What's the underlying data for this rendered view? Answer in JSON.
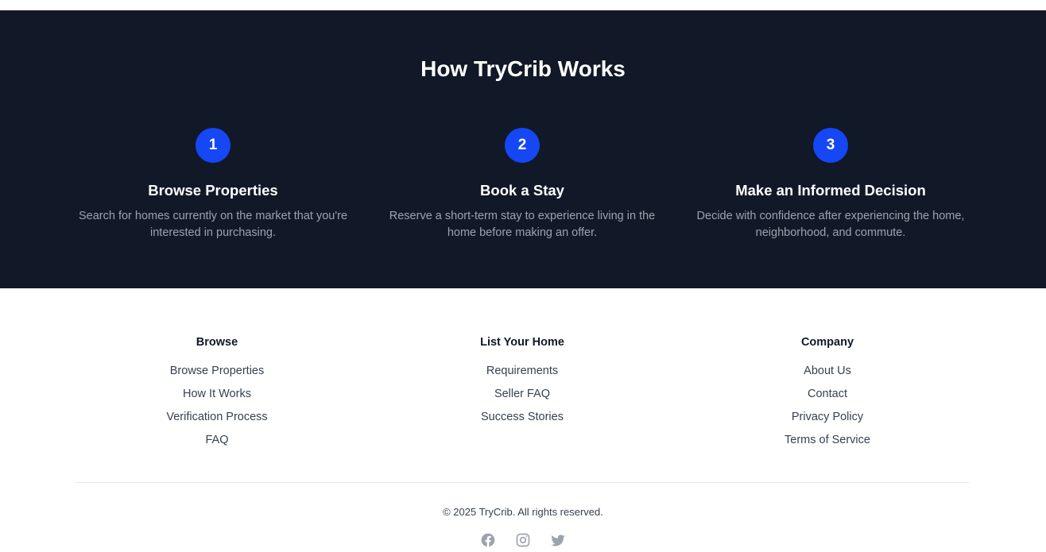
{
  "how_it_works": {
    "title": "How TryCrib Works",
    "steps": [
      {
        "number": "1",
        "heading": "Browse Properties",
        "description": "Search for homes currently on the market that you're interested in purchasing."
      },
      {
        "number": "2",
        "heading": "Book a Stay",
        "description": "Reserve a short-term stay to experience living in the home before making an offer."
      },
      {
        "number": "3",
        "heading": "Make an Informed Decision",
        "description": "Decide with confidence after experiencing the home, neighborhood, and commute."
      }
    ]
  },
  "footer": {
    "columns": [
      {
        "title": "Browse",
        "links": [
          "Browse Properties",
          "How It Works",
          "Verification Process",
          "FAQ"
        ]
      },
      {
        "title": "List Your Home",
        "links": [
          "Requirements",
          "Seller FAQ",
          "Success Stories"
        ]
      },
      {
        "title": "Company",
        "links": [
          "About Us",
          "Contact",
          "Privacy Policy",
          "Terms of Service"
        ]
      }
    ],
    "copyright": "© 2025 TryCrib. All rights reserved.",
    "socials": [
      "facebook-icon",
      "instagram-icon",
      "twitter-icon"
    ]
  },
  "colors": {
    "dark_bg": "#111827",
    "accent": "#1547f5",
    "muted_text": "#9ca3af",
    "icon_gray": "#9ca3af"
  }
}
